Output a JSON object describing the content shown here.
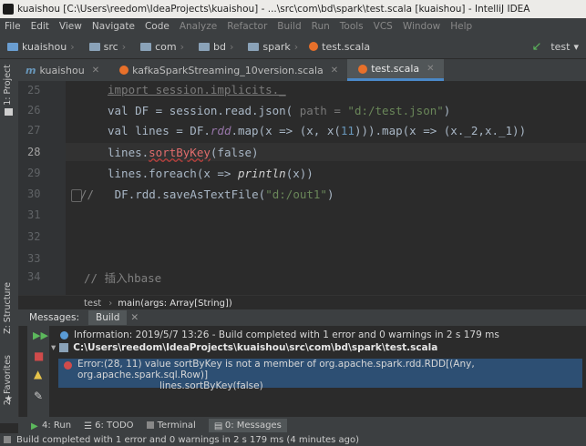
{
  "window": {
    "title": "kuaishou [C:\\Users\\reedom\\IdeaProjects\\kuaishou] - ...\\src\\com\\bd\\spark\\test.scala [kuaishou] - IntelliJ IDEA"
  },
  "menu": [
    "File",
    "Edit",
    "View",
    "Navigate",
    "Code",
    "Analyze",
    "Refactor",
    "Build",
    "Run",
    "Tools",
    "VCS",
    "Window",
    "Help"
  ],
  "breadcrumbs": [
    "kuaishou",
    "src",
    "com",
    "bd",
    "spark",
    "test.scala"
  ],
  "run_config": "test",
  "tabs": [
    {
      "label": "kuaishou"
    },
    {
      "label": "kafkaSparkStreaming_10version.scala"
    },
    {
      "label": "test.scala"
    }
  ],
  "side_labels": {
    "project": "1: Project",
    "structure": "Z: Structure",
    "favorites": "2: Favorites"
  },
  "editor": {
    "lines": [
      "25",
      "26",
      "27",
      "28",
      "29",
      "30",
      "31",
      "32",
      "33",
      "34"
    ],
    "code": {
      "l25": "import session.implicits._",
      "l26_a": "val DF = session.read.json(",
      "l26_hint": " path = ",
      "l26_str": "\"d:/test.json\"",
      "l26_end": ")",
      "l27_a": "val lines = DF.",
      "l27_rdd": "rdd",
      "l27_b": ".map(x => (x, x(",
      "l27_n": "11",
      "l27_c": "))).map(x => (x._2,x._1))",
      "l28_a": "lines.",
      "l28_err": "sortByKey",
      "l28_b": "(false)",
      "l29_a": "lines.foreach(x => ",
      "l29_fn": "println",
      "l29_b": "(x))",
      "l30_cmt": "//",
      "l30_a": "DF.rdd.saveAsTextFile(",
      "l30_str": "\"d:/out1\"",
      "l30_end": ")",
      "l34": "// 插入hbase"
    }
  },
  "editor_breadcrumb": {
    "obj": "test",
    "method": "main(args: Array[String])"
  },
  "messages": {
    "header": "Messages:",
    "tab": "Build",
    "items": [
      {
        "kind": "info",
        "text": "Information: 2019/5/7 13:26 - Build completed with 1 error and 0 warnings in 2 s 179 ms"
      },
      {
        "kind": "file",
        "text": "C:\\Users\\reedom\\IdeaProjects\\kuaishou\\src\\com\\bd\\spark\\test.scala"
      },
      {
        "kind": "error",
        "text": "Error:(28, 11)  value sortByKey is not a member of org.apache.spark.rdd.RDD[(Any, org.apache.spark.sql.Row)]"
      },
      {
        "kind": "error_detail",
        "text": "lines.sortByKey(false)"
      }
    ]
  },
  "bottom_tabs": [
    "4: Run",
    "6: TODO",
    "Terminal",
    "0: Messages"
  ],
  "status": "Build completed with 1 error and 0 warnings in 2 s 179 ms (4 minutes ago)",
  "colors": {
    "accent": "#4a88c7",
    "error": "#d04b4b",
    "info": "#5a9bd5",
    "keyword": "#cc7832"
  }
}
